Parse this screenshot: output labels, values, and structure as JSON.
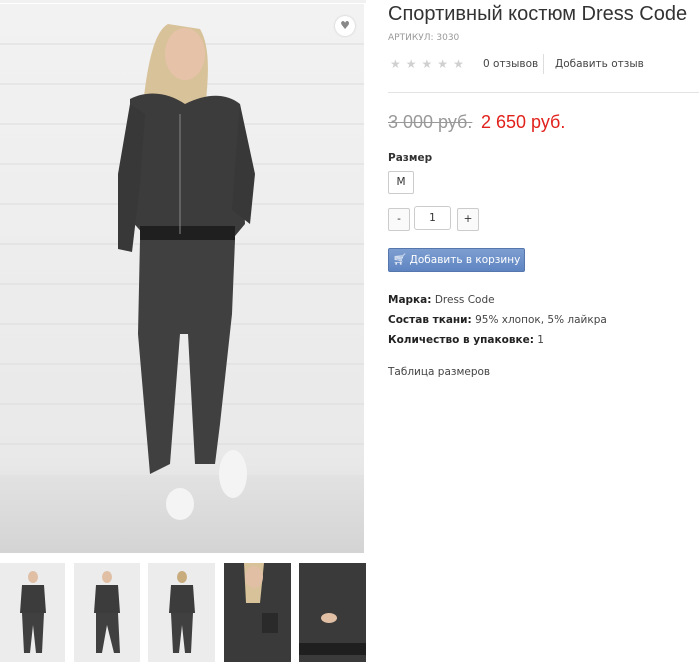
{
  "product": {
    "title": "Спортивный костюм Dress Code",
    "sku_label": "АРТИКУЛ:",
    "sku": "3030",
    "reviews_count": "0 отзывов",
    "write_review": "Добавить отзыв",
    "old_price": "3 000 руб.",
    "new_price": "2 650 руб.",
    "size_label": "Размер",
    "size_option": "M",
    "qty_minus": "-",
    "qty_value": "1",
    "qty_plus": "+",
    "cart_button": "Добавить в корзину",
    "brand_label": "Марка:",
    "brand_value": "Dress Code",
    "fabric_label": "Состав ткани:",
    "fabric_value": "95% хлопок, 5% лайкра",
    "pack_label": "Количество в упаковке:",
    "pack_value": "1",
    "size_table": "Таблица размеров",
    "rating": 0,
    "rating_max": 5
  },
  "icons": {
    "favorite": "heart-icon",
    "cart": "shopping-cart-icon",
    "star": "star-icon"
  },
  "colors": {
    "price_new": "#e1211b",
    "price_old": "#999999",
    "button": "#6a8dc8",
    "suit": "#3d3d3d"
  }
}
